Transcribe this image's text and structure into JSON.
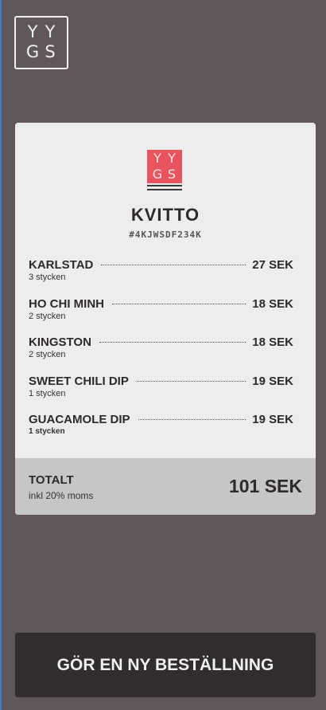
{
  "brand": {
    "logo_letters": [
      "Y",
      "Y",
      "G",
      "S"
    ]
  },
  "receipt": {
    "title": "KVITTO",
    "order_id": "#4KJWSDF234K",
    "items": [
      {
        "name": "KARLSTAD",
        "price": "27 SEK",
        "qty": "3 stycken"
      },
      {
        "name": "HO CHI MINH",
        "price": "18 SEK",
        "qty": "2 stycken"
      },
      {
        "name": "KINGSTON",
        "price": "18 SEK",
        "qty": "2 stycken"
      },
      {
        "name": "SWEET CHILI DIP",
        "price": "19 SEK",
        "qty": "1 stycken"
      },
      {
        "name": "GUACAMOLE DIP",
        "price": "19 SEK",
        "qty": "1 stycken"
      }
    ],
    "total_label": "TOTALT",
    "total_sub": "inkl 20% moms",
    "total_value": "101 SEK"
  },
  "actions": {
    "new_order_label": "GÖR EN NY BESTÄLLNING"
  },
  "colors": {
    "background": "#605858",
    "card": "#ededed",
    "accent": "#ea545c",
    "button": "#312d2d"
  }
}
